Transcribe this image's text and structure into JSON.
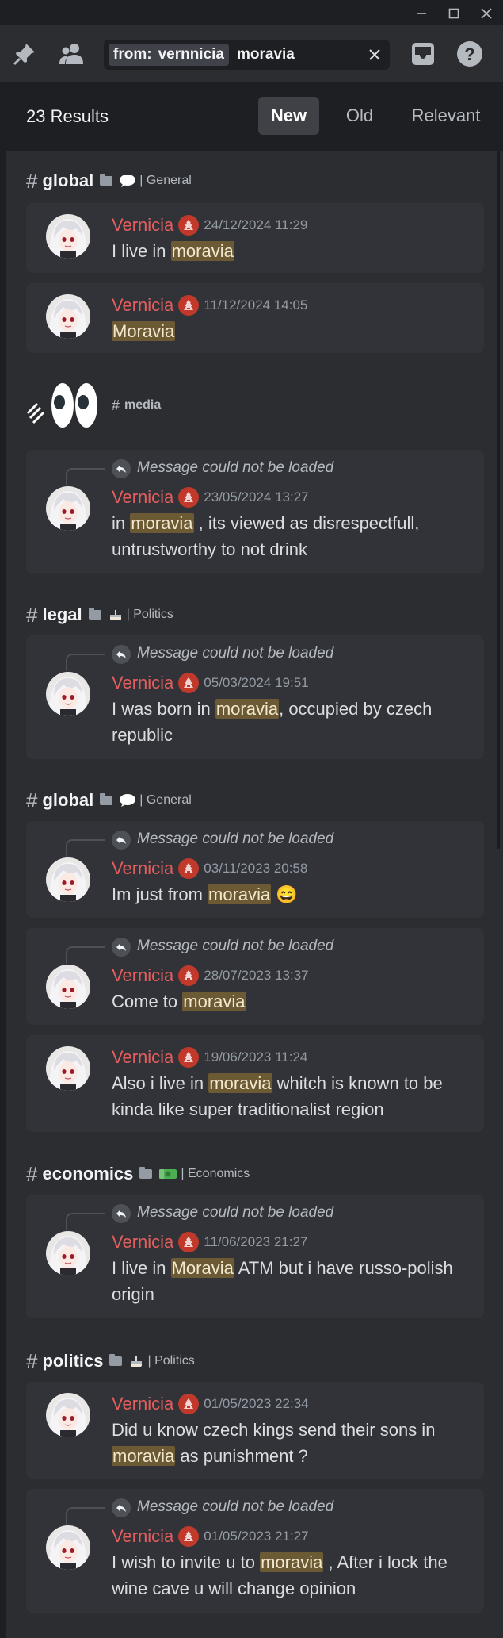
{
  "search": {
    "filter_key": "from:",
    "filter_value": "vernnicia",
    "term": "moravia"
  },
  "results": {
    "count_label": "23 Results",
    "sort_options": [
      "New",
      "Old",
      "Relevant"
    ],
    "active_sort": "New"
  },
  "reply_unavailable": "Message could not be loaded",
  "sections": [
    {
      "channel": "global",
      "category": "| General",
      "emoji": "speech-balloon",
      "messages": [
        {
          "author": "Vernicia",
          "timestamp": "24/12/2024 11:29",
          "reply": false,
          "pre": "I live in ",
          "hit": "moravia",
          "post": ""
        },
        {
          "author": "Vernicia",
          "timestamp": "11/12/2024 14:05",
          "reply": false,
          "pre": "",
          "hit": "Moravia",
          "post": ""
        }
      ]
    },
    {
      "channel": "media",
      "category": "",
      "emoji": "eyes",
      "messages": [
        {
          "author": "Vernicia",
          "timestamp": "23/05/2024 13:27",
          "reply": true,
          "pre": "in ",
          "hit": "moravia",
          "post": " , its viewed as disrespectfull, untrustworthy to not drink"
        }
      ]
    },
    {
      "channel": "legal",
      "category": "| Politics",
      "emoji": "cake",
      "messages": [
        {
          "author": "Vernicia",
          "timestamp": "05/03/2024 19:51",
          "reply": true,
          "pre": "I was born in ",
          "hit": "moravia",
          "post": ", occupied by czech republic"
        }
      ]
    },
    {
      "channel": "global",
      "category": "| General",
      "emoji": "speech-balloon",
      "messages": [
        {
          "author": "Vernicia",
          "timestamp": "03/11/2023 20:58",
          "reply": true,
          "pre": "Im just from ",
          "hit": "moravia",
          "post": " 😄"
        },
        {
          "author": "Vernicia",
          "timestamp": "28/07/2023 13:37",
          "reply": true,
          "pre": "Come to ",
          "hit": "moravia",
          "post": ""
        },
        {
          "author": "Vernicia",
          "timestamp": "19/06/2023 11:24",
          "reply": false,
          "pre": "Also i live in ",
          "hit": "moravia",
          "post": " whitch is known to be kinda like super traditionalist region"
        }
      ]
    },
    {
      "channel": "economics",
      "category": "| Economics",
      "emoji": "money",
      "messages": [
        {
          "author": "Vernicia",
          "timestamp": "11/06/2023 21:27",
          "reply": true,
          "pre": "I live in ",
          "hit": "Moravia",
          "post": " ATM but i have russo-polish origin"
        }
      ]
    },
    {
      "channel": "politics",
      "category": "| Politics",
      "emoji": "cake",
      "messages": [
        {
          "author": "Vernicia",
          "timestamp": "01/05/2023 22:34",
          "reply": false,
          "pre": "Did u know czech kings send their sons in ",
          "hit": "moravia",
          "post": " as punishment ?"
        },
        {
          "author": "Vernicia",
          "timestamp": "01/05/2023 21:27",
          "reply": true,
          "pre": "I wish to invite u to ",
          "hit": "moravia",
          "post": " , After i lock the wine cave u will change opinion"
        }
      ]
    }
  ]
}
